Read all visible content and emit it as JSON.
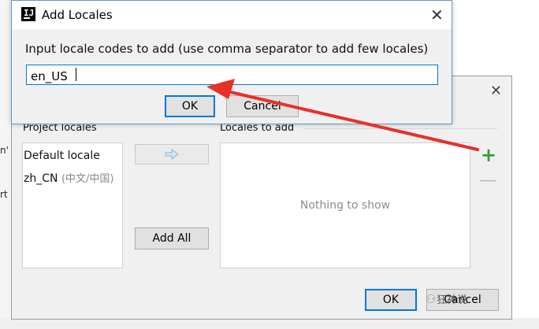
{
  "background": {
    "fragments": [
      "n'",
      "rt"
    ]
  },
  "locales_dialog": {
    "project_locales_label": "Project locales",
    "locales_to_add_label": "Locales to add",
    "project_locales": [
      {
        "code": "Default locale",
        "native": ""
      },
      {
        "code": "zh_CN",
        "native": "(中文/中国)"
      }
    ],
    "empty_text": "Nothing to show",
    "move_icon": "arrow-right-icon",
    "add_all_label": "Add All",
    "add_icon_glyph": "+",
    "remove_icon_glyph": "—",
    "close_glyph": "✕",
    "ok_label": "OK",
    "cancel_label": "Cancel"
  },
  "add_locales_dialog": {
    "title": "Add Locales",
    "app_icon_text": "IJ",
    "prompt": "Input locale codes to add (use comma separator to add few locales)",
    "input_value": "en_US",
    "ok_label": "OK",
    "cancel_label": "Cancel",
    "close_glyph": "✕"
  },
  "annotation": {
    "color": "#e8302a"
  },
  "watermark": {
    "text": "狂神说",
    "icon_glyph": "⚇"
  }
}
